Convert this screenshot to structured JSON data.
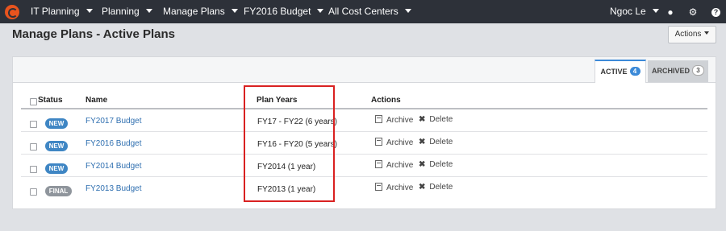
{
  "nav": {
    "items": [
      {
        "label": "IT Planning"
      },
      {
        "label": "Planning"
      },
      {
        "label": "Manage Plans"
      },
      {
        "label": "FY2016 Budget"
      },
      {
        "label": "All Cost Centers"
      }
    ],
    "user": "Ngoc Le",
    "icons": [
      "chat-icon",
      "gear-icon",
      "help-icon"
    ]
  },
  "page": {
    "title": "Manage Plans - Active Plans",
    "actions_label": "Actions"
  },
  "tabs": [
    {
      "label": "ACTIVE",
      "count": "4"
    },
    {
      "label": "ARCHIVED",
      "count": "3"
    }
  ],
  "table": {
    "headers": [
      "Status",
      "Name",
      "Plan Years",
      "Actions"
    ],
    "rows": [
      {
        "status": "NEW",
        "name": "FY2017 Budget",
        "years": "FY17 - FY22 (6 years)"
      },
      {
        "status": "NEW",
        "name": "FY2016 Budget",
        "years": "FY16 - FY20 (5 years)"
      },
      {
        "status": "NEW",
        "name": "FY2014 Budget",
        "years": "FY2014 (1 year)"
      },
      {
        "status": "FINAL",
        "name": "FY2013 Budget",
        "years": "FY2013 (1 year)"
      }
    ],
    "row_actions": {
      "archive": "Archive",
      "delete": "Delete"
    }
  },
  "colors": {
    "topbar": "#2d3139",
    "accent": "#3c8ad8",
    "link": "#2f6fb0",
    "status_new": "#3f86c4",
    "status_final": "#8f959c",
    "highlight": "#d92121"
  }
}
